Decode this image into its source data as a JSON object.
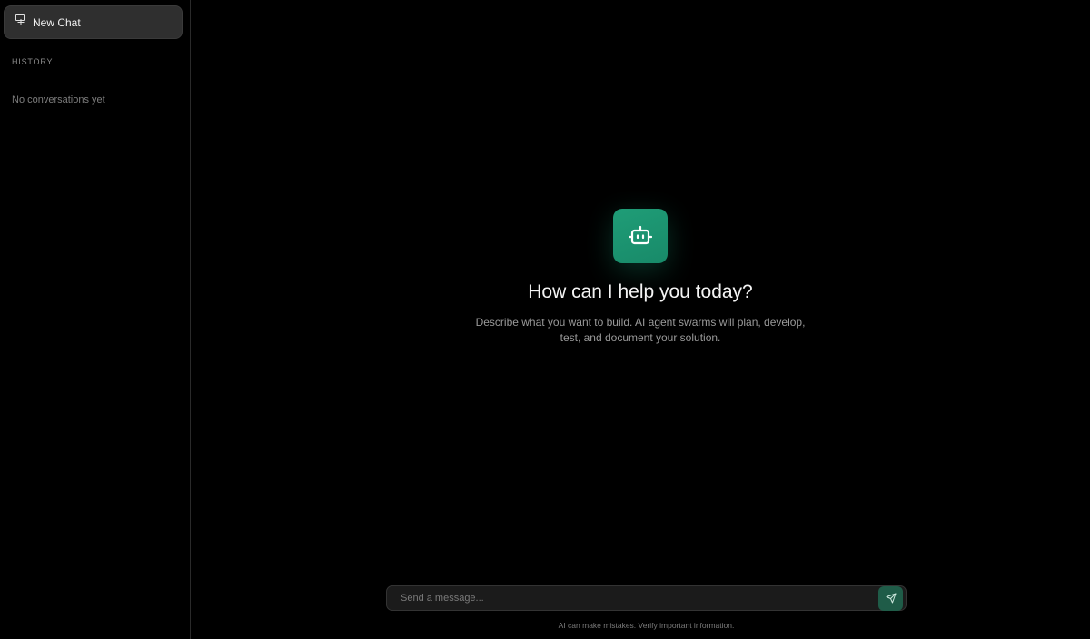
{
  "sidebar": {
    "new_chat_label": "New Chat",
    "history_heading": "HISTORY",
    "empty_history": "No conversations yet"
  },
  "hero": {
    "icon": "bot-icon",
    "title": "How can I help you today?",
    "subtitle": "Describe what you want to build. AI agent swarms will plan, develop, test, and document your solution."
  },
  "composer": {
    "placeholder": "Send a message...",
    "value": "",
    "send_icon": "send-icon"
  },
  "footer": {
    "disclaimer": "AI can make mistakes. Verify important information."
  },
  "colors": {
    "accent": "#1f9d77",
    "send_button": "#1f5c48",
    "background": "#000000",
    "sidebar_button": "#2f2f2f"
  }
}
